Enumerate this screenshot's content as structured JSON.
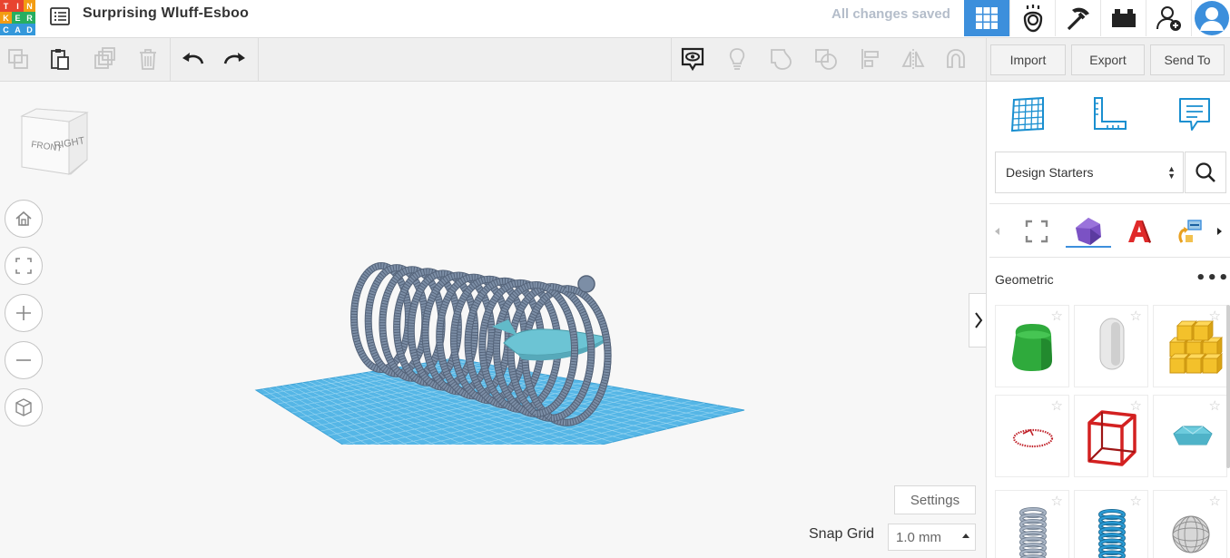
{
  "header": {
    "logo_letters": [
      "T",
      "I",
      "N",
      "K",
      "E",
      "R",
      "C",
      "A",
      "D"
    ],
    "logo_colors": [
      "#e8442f",
      "#e8442f",
      "#f39c12",
      "#f39c12",
      "#27ae60",
      "#27ae60",
      "#3498db",
      "#3498db",
      "#3498db"
    ],
    "design_title": "Surprising Wluff-Esboo",
    "save_status": "All changes saved",
    "icons": [
      "3d-design-icon",
      "circuits-icon",
      "codeblocks-icon",
      "lego-bricks-icon",
      "invite-user-icon",
      "user-avatar-icon"
    ]
  },
  "toolbar": {
    "import_label": "Import",
    "export_label": "Export",
    "send_to_label": "Send To"
  },
  "viewcube": {
    "front_label": "FRONT",
    "right_label": "RIGHT"
  },
  "workplane": {
    "settings_label": "Settings",
    "snap_grid_label": "Snap Grid",
    "snap_grid_value": "1.0 mm"
  },
  "panel": {
    "library_select": "Design Starters",
    "category_title": "Geometric",
    "shapes": [
      "Rounded Box",
      "Capsule",
      "Cube Grid",
      "Circle Outline",
      "Wire Cube",
      "Gem",
      "Spring Gray",
      "Spring Blue",
      "Wire Sphere"
    ]
  },
  "colors": {
    "accent": "#3c8fdc",
    "grid": "#55b6e6",
    "spring": "#7c8ea6"
  }
}
